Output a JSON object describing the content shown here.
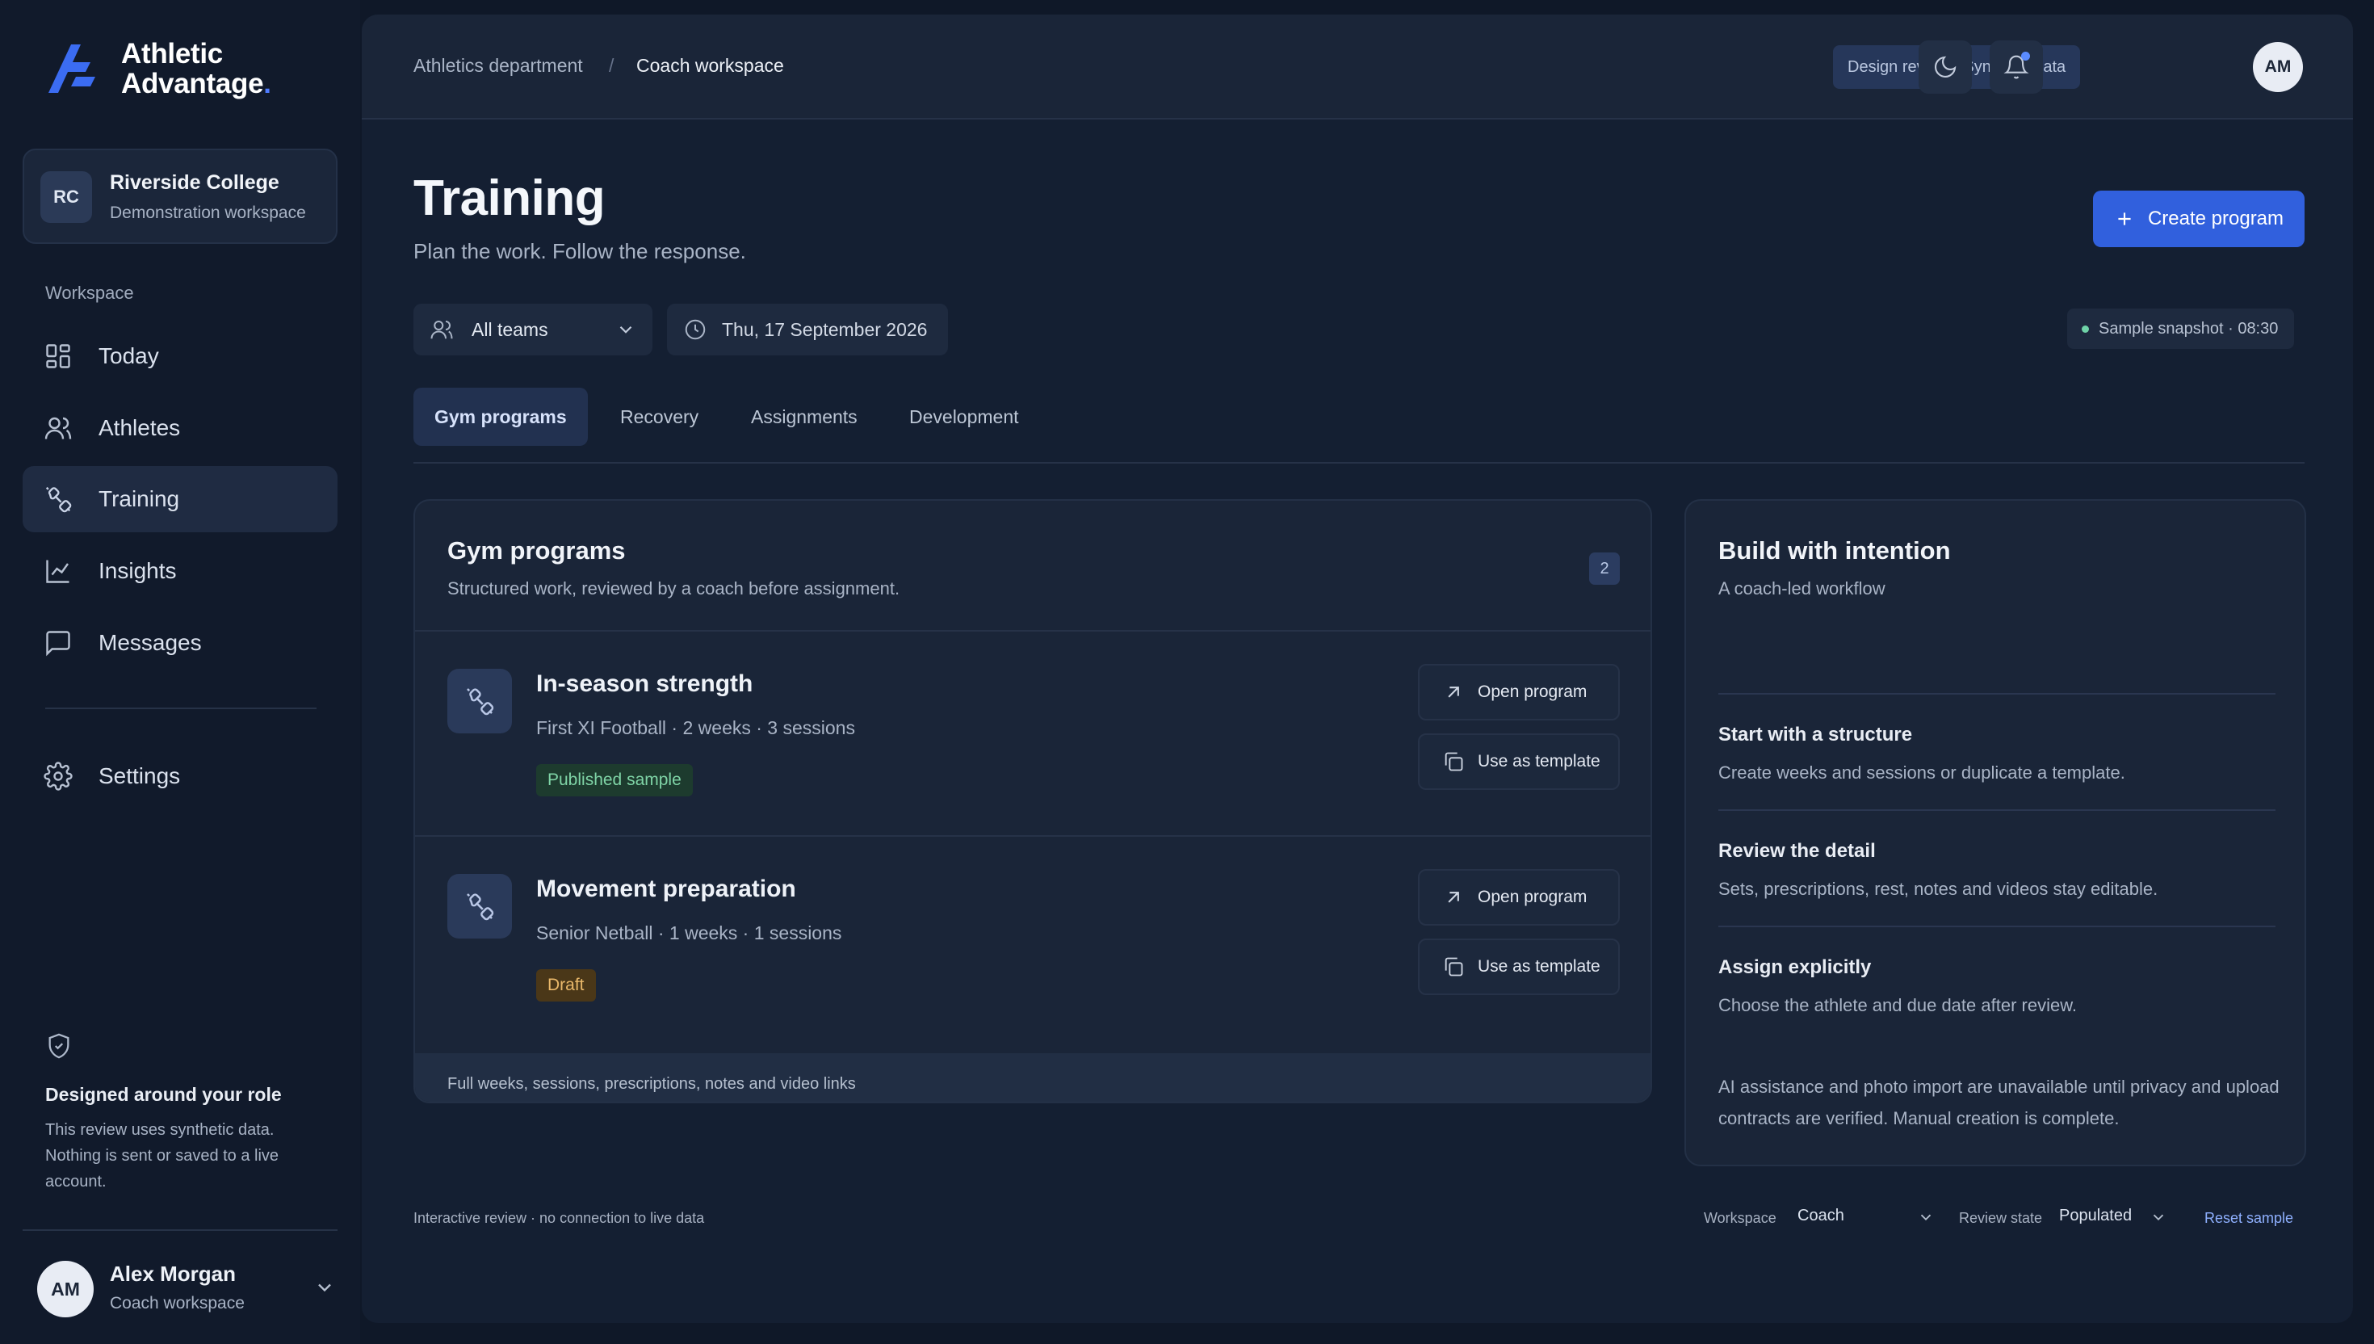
{
  "brand": {
    "name_line1": "Athletic",
    "name_line2": "Advantage",
    "name_dot": ".",
    "icon": "athletic-advantage-logo"
  },
  "org": {
    "initials": "RC",
    "name": "Riverside College",
    "subtitle": "Demonstration workspace"
  },
  "sidebar": {
    "section_label": "Workspace",
    "items": [
      {
        "label": "Today",
        "icon": "dashboard-grid-icon",
        "active": false
      },
      {
        "label": "Athletes",
        "icon": "users-icon",
        "active": false
      },
      {
        "label": "Training",
        "icon": "dumbbell-icon",
        "active": true
      },
      {
        "label": "Insights",
        "icon": "line-chart-icon",
        "active": false
      },
      {
        "label": "Messages",
        "icon": "message-square-icon",
        "active": false
      }
    ],
    "settings_label": "Settings",
    "role_title": "Designed around your role",
    "role_text": "This review uses synthetic data. Nothing is sent or saved to a live account.",
    "user": {
      "initials": "AM",
      "name": "Alex Morgan",
      "subtitle": "Coach workspace"
    }
  },
  "topbar": {
    "breadcrumb_1": "Athletics department",
    "breadcrumb_sep": "/",
    "breadcrumb_2": "Coach workspace",
    "review_badge": "Design review · Synthetic data",
    "avatar_initials": "AM"
  },
  "page": {
    "title": "Training",
    "subtitle": "Plan the work. Follow the response.",
    "create_label": "Create program",
    "team_filter": "All teams",
    "date_filter": "Thu, 17 September 2026",
    "snapshot": "Sample snapshot · 08:30"
  },
  "tabs": [
    {
      "label": "Gym programs",
      "active": true
    },
    {
      "label": "Recovery",
      "active": false
    },
    {
      "label": "Assignments",
      "active": false
    },
    {
      "label": "Development",
      "active": false
    }
  ],
  "programs": {
    "title": "Gym programs",
    "subtitle": "Structured work, reviewed by a coach before assignment.",
    "count": "2",
    "open_label": "Open program",
    "template_label": "Use as template",
    "items": [
      {
        "name": "In-season strength",
        "meta": "First XI Football · 2 weeks · 3 sessions",
        "status": "Published sample"
      },
      {
        "name": "Movement preparation",
        "meta": "Senior Netball · 1 weeks · 1 sessions",
        "status": "Draft"
      }
    ],
    "footer": "Full weeks, sessions, prescriptions, notes and video links"
  },
  "guide": {
    "title": "Build with intention",
    "subtitle": "A coach-led workflow",
    "steps": [
      {
        "title": "Start with a structure",
        "text": "Create weeks and sessions or duplicate a template."
      },
      {
        "title": "Review the detail",
        "text": "Sets, prescriptions, rest, notes and videos stay editable."
      },
      {
        "title": "Assign explicitly",
        "text": "Choose the athlete and due date after review."
      }
    ],
    "note": "AI assistance and photo import are unavailable until privacy and upload contracts are verified. Manual creation is complete."
  },
  "footer": {
    "left": "Interactive review · no connection to live data",
    "workspace_label": "Workspace",
    "workspace_value": "Coach",
    "review_label": "Review state",
    "review_value": "Populated",
    "reset_label": "Reset sample"
  }
}
